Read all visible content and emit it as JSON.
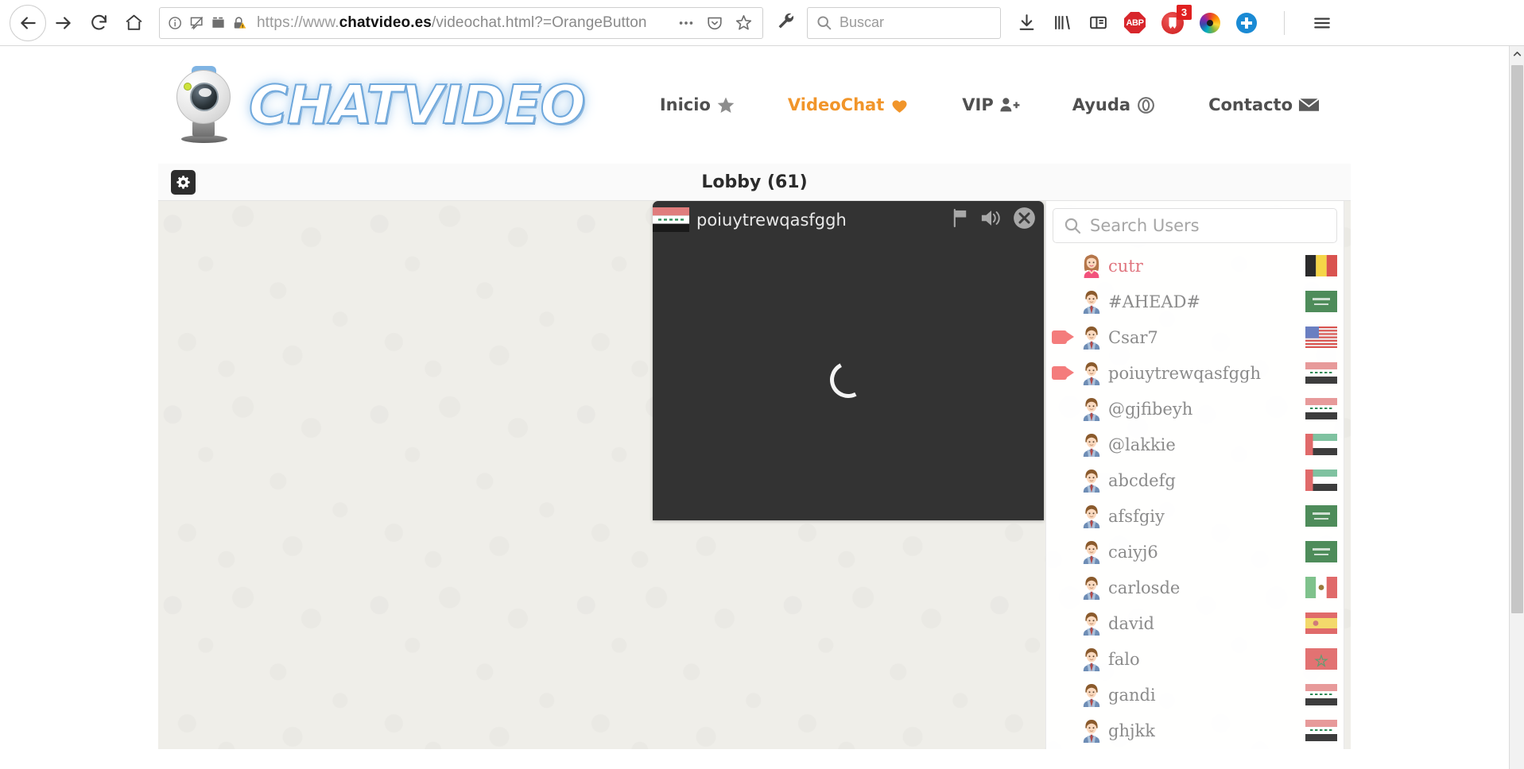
{
  "browser": {
    "back_label": "Back",
    "forward_label": "Forward",
    "reload_label": "Reload",
    "home_label": "Home",
    "url": {
      "scheme": "https://www.",
      "domain": "chatvideo.es",
      "path": "/videochat.html?=OrangeButton",
      "full": "https://www.chatvideo.es/videochat.html?=OrangeButton"
    },
    "search_placeholder": "Buscar",
    "extensions": {
      "abp_label": "ABP",
      "ghostery_count": "3"
    }
  },
  "site": {
    "logo_text": "CHATVIDEO",
    "nav": [
      {
        "label": "Inicio",
        "icon": "star-icon",
        "active": false
      },
      {
        "label": "VideoChat",
        "icon": "heart-icon",
        "active": true
      },
      {
        "label": "VIP",
        "icon": "user-add-icon",
        "active": false
      },
      {
        "label": "Ayuda",
        "icon": "lifebuoy-icon",
        "active": false
      },
      {
        "label": "Contacto",
        "icon": "envelope-icon",
        "active": false
      }
    ],
    "accent_color": "#f1952a"
  },
  "lobby": {
    "title": "Lobby (61)",
    "settings_icon": "gear-icon"
  },
  "video": {
    "username": "poiuytrewqasfggh",
    "country": "Iraq",
    "state": "loading",
    "controls": {
      "report": "flag-icon",
      "sound": "speaker-icon",
      "close": "close-icon"
    }
  },
  "userlist": {
    "search_placeholder": "Search Users",
    "users": [
      {
        "name": "cutr",
        "gender": "female",
        "camera": false,
        "country": "Belgium"
      },
      {
        "name": "#AHEAD#",
        "gender": "male",
        "camera": false,
        "country": "Saudi Arabia"
      },
      {
        "name": "Csar7",
        "gender": "male",
        "camera": true,
        "country": "United States"
      },
      {
        "name": "poiuytrewqasfggh",
        "gender": "male",
        "camera": true,
        "country": "Iraq"
      },
      {
        "name": "@gjfibeyh",
        "gender": "male",
        "camera": false,
        "country": "Iraq"
      },
      {
        "name": "@lakkie",
        "gender": "male",
        "camera": false,
        "country": "United Arab Emirates"
      },
      {
        "name": "abcdefg",
        "gender": "male",
        "camera": false,
        "country": "United Arab Emirates"
      },
      {
        "name": "afsfgiy",
        "gender": "male",
        "camera": false,
        "country": "Saudi Arabia"
      },
      {
        "name": "caiyj6",
        "gender": "male",
        "camera": false,
        "country": "Saudi Arabia"
      },
      {
        "name": "carlosde",
        "gender": "male",
        "camera": false,
        "country": "Mexico"
      },
      {
        "name": "david",
        "gender": "male",
        "camera": false,
        "country": "Spain"
      },
      {
        "name": "falo",
        "gender": "male",
        "camera": false,
        "country": "Morocco"
      },
      {
        "name": "gandi",
        "gender": "male",
        "camera": false,
        "country": "Iraq"
      },
      {
        "name": "ghjkk",
        "gender": "male",
        "camera": false,
        "country": "Iraq"
      }
    ]
  }
}
